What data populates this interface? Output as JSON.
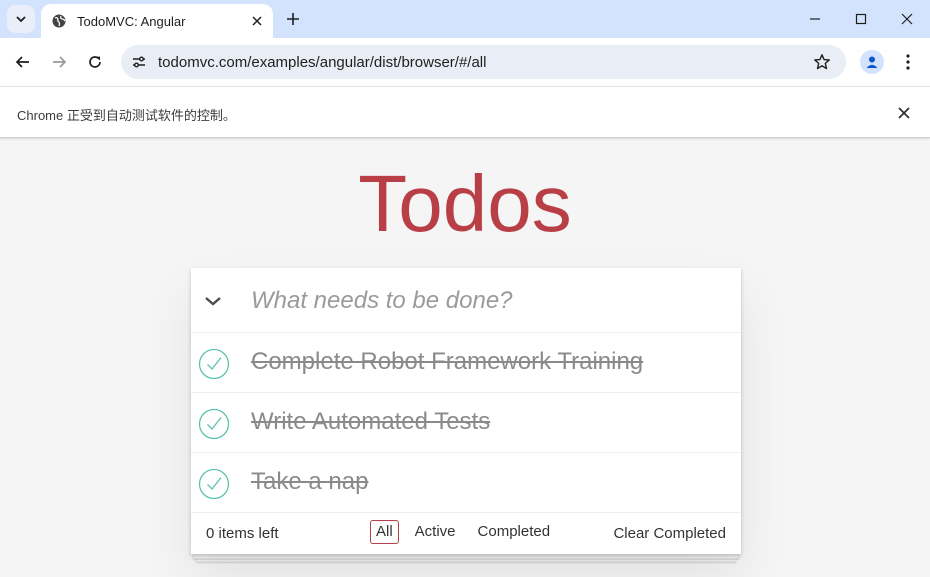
{
  "browser": {
    "tab_title": "TodoMVC: Angular",
    "url": "todomvc.com/examples/angular/dist/browser/#/all",
    "infobar_message": "Chrome 正受到自动测试软件的控制。"
  },
  "app": {
    "title": "Todos",
    "new_todo_placeholder": "What needs to be done?",
    "todos": [
      {
        "title": "Complete Robot Framework Training",
        "completed": true
      },
      {
        "title": "Write Automated Tests",
        "completed": true
      },
      {
        "title": "Take a nap",
        "completed": true
      }
    ],
    "footer": {
      "items_left": "0 items left",
      "filters": [
        "All",
        "Active",
        "Completed"
      ],
      "selected_filter": "All",
      "clear_completed": "Clear Completed"
    }
  },
  "colors": {
    "accent": "#b83f45",
    "check": "#5dc2af",
    "tabbar": "#d3e3fd"
  },
  "icons": {
    "tab_search": "chevron-down-icon",
    "favicon": "globe-icon",
    "toggle_all": "chevron-down-icon",
    "completed": "check-circle-icon"
  }
}
